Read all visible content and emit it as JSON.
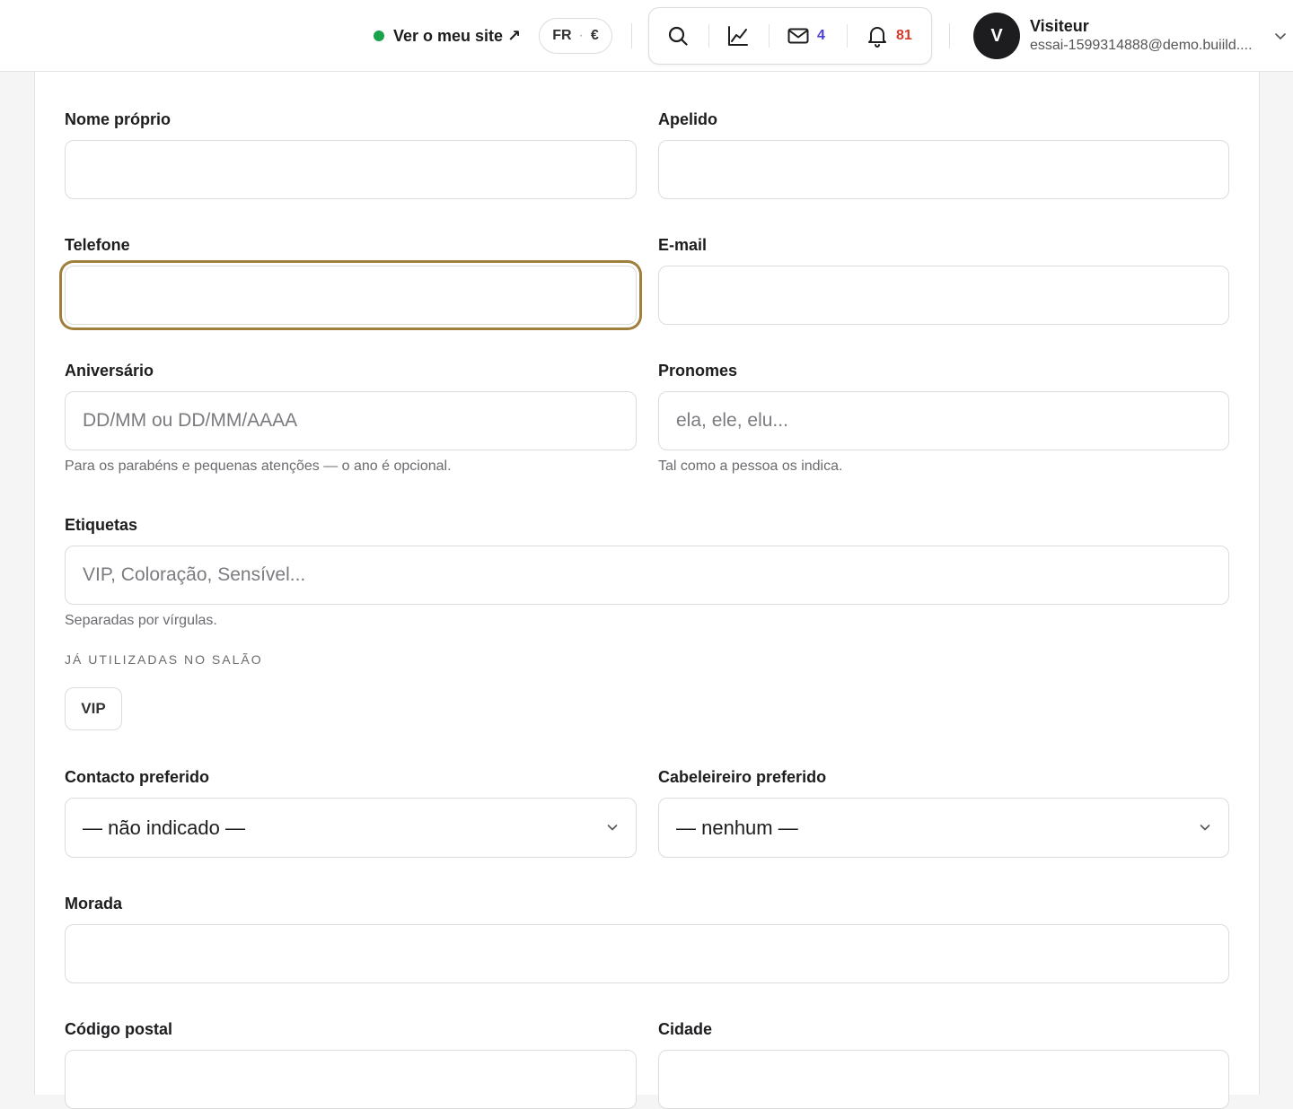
{
  "header": {
    "site_link_label": "Ver o meu site ↗",
    "locale": {
      "language": "FR",
      "separator": "·",
      "currency": "€"
    },
    "messages_count": "4",
    "notifications_count": "81",
    "user": {
      "initial": "V",
      "name": "Visiteur",
      "email": "essai-1599314888@demo.buiild...."
    }
  },
  "form": {
    "first_name": {
      "label": "Nome próprio",
      "value": ""
    },
    "last_name": {
      "label": "Apelido",
      "value": ""
    },
    "phone": {
      "label": "Telefone",
      "value": ""
    },
    "email": {
      "label": "E-mail",
      "value": ""
    },
    "birthday": {
      "label": "Aniversário",
      "placeholder": "DD/MM ou DD/MM/AAAA",
      "hint": "Para os parabéns e pequenas atenções — o ano é opcional."
    },
    "pronouns": {
      "label": "Pronomes",
      "placeholder": "ela, ele, elu...",
      "hint": "Tal como a pessoa os indica."
    },
    "tags": {
      "label": "Etiquetas",
      "placeholder": "VIP, Coloração, Sensível...",
      "hint": "Separadas por vírgulas.",
      "used_title": "JÁ UTILIZADAS NO SALÃO",
      "used": [
        "VIP"
      ]
    },
    "preferred_contact": {
      "label": "Contacto preferido",
      "value": "— não indicado —"
    },
    "preferred_stylist": {
      "label": "Cabeleireiro preferido",
      "value": "— nenhum —"
    },
    "address": {
      "label": "Morada",
      "value": ""
    },
    "postal_code": {
      "label": "Código postal",
      "value": ""
    },
    "city": {
      "label": "Cidade",
      "value": ""
    }
  },
  "colors": {
    "status_dot": "#1aa34a",
    "messages_accent": "#4b3fd6",
    "notifications_accent": "#d23a2a",
    "focus_ring": "#a07e3c"
  },
  "icons": [
    "external-link-icon",
    "search-icon",
    "stats-chart-icon",
    "mail-icon",
    "bell-icon",
    "chevron-down-icon"
  ]
}
